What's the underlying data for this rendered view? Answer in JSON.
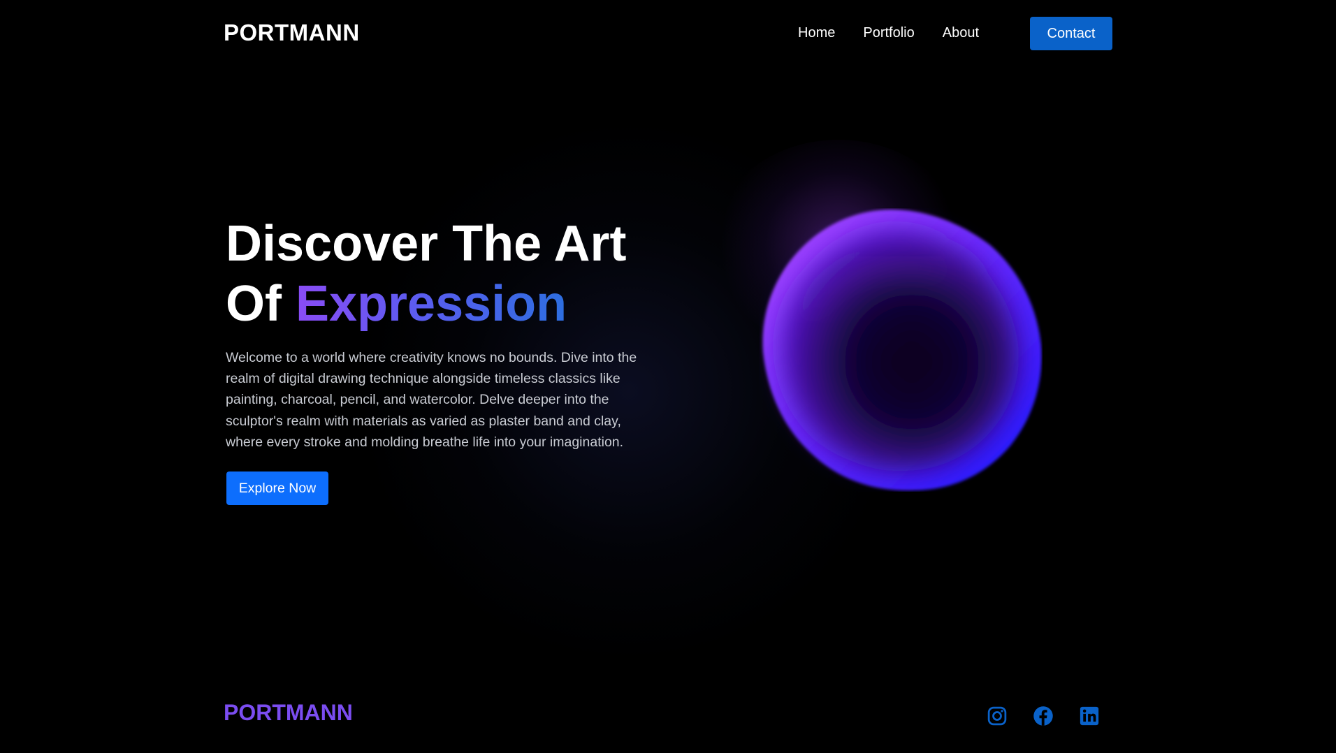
{
  "header": {
    "brand": "PORTMANN",
    "nav": [
      "Home",
      "Portfolio",
      "About"
    ],
    "contact_label": "Contact"
  },
  "hero": {
    "title_line1": "Discover The Art",
    "title_line2_prefix": "Of ",
    "title_line2_highlight": "Expression",
    "description": "Welcome to a world where creativity knows no bounds. Dive into the realm of digital drawing technique alongside timeless classics like painting, charcoal, pencil, and watercolor. Delve deeper into the sculptor's realm with materials as varied as plaster band and clay, where every stroke and molding breathe life into your imagination.",
    "cta_label": "Explore Now"
  },
  "footer": {
    "brand": "PORTMANN",
    "social_icons": [
      "instagram-icon",
      "facebook-icon",
      "linkedin-icon"
    ]
  },
  "colors": {
    "background": "#000000",
    "accent_blue": "#0d6efd",
    "contact_blue": "#0a62c9",
    "gradient_start": "#8a4cf5",
    "gradient_end": "#2d6ee0",
    "footer_brand": "#7b4df1",
    "social_icon": "#0a62c9"
  }
}
